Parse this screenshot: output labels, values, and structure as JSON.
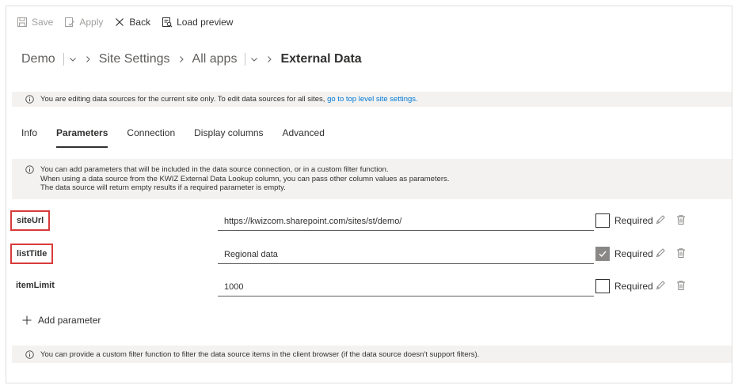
{
  "toolbar": {
    "save": "Save",
    "apply": "Apply",
    "back": "Back",
    "load_preview": "Load preview"
  },
  "breadcrumb": {
    "root": "Demo",
    "site_settings": "Site Settings",
    "all_apps": "All apps",
    "current": "External Data"
  },
  "info_site": {
    "text": "You are editing data sources for the current site only. To edit data sources for all sites, ",
    "link": "go to top level site settings."
  },
  "tabs": [
    {
      "label": "Info"
    },
    {
      "label": "Parameters",
      "active": true
    },
    {
      "label": "Connection"
    },
    {
      "label": "Display columns"
    },
    {
      "label": "Advanced"
    }
  ],
  "info_params": {
    "line1": "You can add parameters that will be included in the data source connection, or in a custom filter function.",
    "line2": "When using a data source from the KWIZ External Data Lookup column, you can pass other column values as parameters.",
    "line3": "The data source will return empty results if a required parameter is empty."
  },
  "parameters": [
    {
      "name": "siteUrl",
      "value": "https://kwizcom.sharepoint.com/sites/st/demo/",
      "required_label": "Required",
      "required": false,
      "highlighted": true
    },
    {
      "name": "listTitle",
      "value": "Regional data",
      "required_label": "Required",
      "required": true,
      "highlighted": true
    },
    {
      "name": "itemLimit",
      "value": "1000",
      "required_label": "Required",
      "required": false,
      "highlighted": false
    }
  ],
  "add_parameter": "Add parameter",
  "info_filter": {
    "text": "You can provide a custom filter function to filter the data source items in the client browser (if the data source doesn't support filters)."
  },
  "colors": {
    "highlight": "#d83b3b",
    "link": "#0078d4",
    "infobar_bg": "#f3f2f1"
  }
}
